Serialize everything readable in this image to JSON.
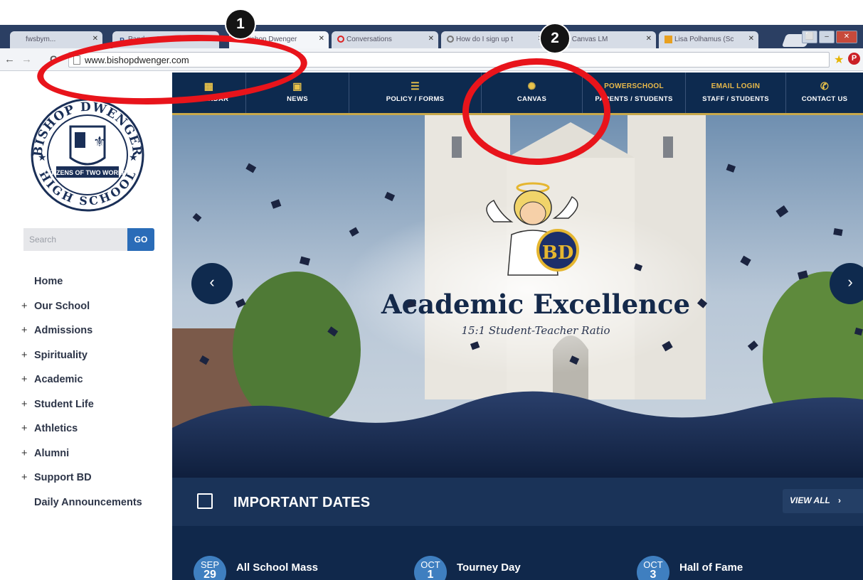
{
  "browser": {
    "tabs": [
      {
        "label": "fwsbym...",
        "favicon": ""
      },
      {
        "label": "Pandora Internet R",
        "favicon": "P"
      },
      {
        "label": "Bishop Dwenger",
        "favicon": ""
      },
      {
        "label": "Conversations",
        "favicon": ""
      },
      {
        "label": "How do I sign up t",
        "favicon": ""
      },
      {
        "label": "s Canvas LM",
        "favicon": ""
      },
      {
        "label": "Lisa Polhamus (Sc",
        "favicon": ""
      }
    ],
    "url": "www.bishopdwenger.com",
    "pinterest_glyph": "P"
  },
  "sidebar": {
    "logo": {
      "top_text": "BISHOP DWENGER",
      "banner": "CITIZENS OF TWO WORLDS",
      "bottom_text": "HIGH SCHOOL"
    },
    "search_placeholder": "Search",
    "go_label": "GO",
    "nav": [
      {
        "label": "Home",
        "expandable": false
      },
      {
        "label": "Our School",
        "expandable": true
      },
      {
        "label": "Admissions",
        "expandable": true
      },
      {
        "label": "Spirituality",
        "expandable": true
      },
      {
        "label": "Academic",
        "expandable": true
      },
      {
        "label": "Student Life",
        "expandable": true
      },
      {
        "label": "Athletics",
        "expandable": true
      },
      {
        "label": "Alumni",
        "expandable": true
      },
      {
        "label": "Support BD",
        "expandable": true
      },
      {
        "label": "Daily Announcements",
        "expandable": false
      }
    ]
  },
  "topnav": [
    {
      "icon": "calendar-icon",
      "label": "CALENDAR"
    },
    {
      "icon": "news-icon",
      "label": "NEWS"
    },
    {
      "icon": "list-icon",
      "label": "POLICY / FORMS"
    },
    {
      "icon": "canvas-icon",
      "label": "CANVAS"
    },
    {
      "top": "POWERSCHOOL",
      "label": "PARENTS / STUDENTS"
    },
    {
      "top": "EMAIL LOGIN",
      "label": "STAFF / STUDENTS"
    },
    {
      "icon": "phone-icon",
      "label": "CONTACT US"
    }
  ],
  "hero": {
    "title": "Academic Excellence",
    "subtitle": "15:1 Student-Teacher Ratio",
    "mascot_monogram": "BD"
  },
  "dates": {
    "title": "IMPORTANT DATES",
    "view_all": "VIEW ALL",
    "events": [
      {
        "month": "SEP",
        "day": "29",
        "name": "All School Mass"
      },
      {
        "month": "OCT",
        "day": "1",
        "name": "Tourney Day"
      },
      {
        "month": "OCT",
        "day": "3",
        "name": "Hall of Fame"
      }
    ]
  },
  "annotations": [
    {
      "number": "1",
      "target": "address-bar"
    },
    {
      "number": "2",
      "target": "canvas-link"
    }
  ],
  "colors": {
    "navy": "#0d2a4f",
    "gold": "#c8a84a",
    "annotation_red": "#e8141b",
    "event_badge": "#3f7fc0"
  }
}
